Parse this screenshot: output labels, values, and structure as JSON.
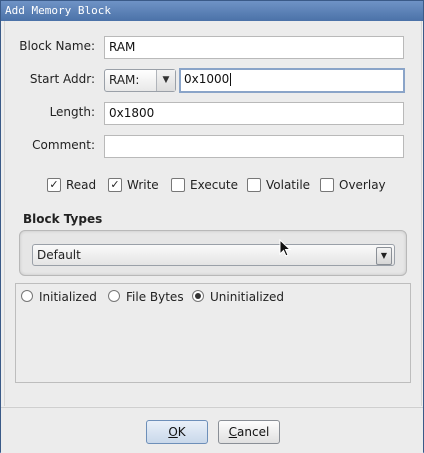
{
  "window": {
    "title": "Add Memory Block"
  },
  "form": {
    "block_name_label": "Block Name:",
    "block_name_value": "RAM",
    "start_addr_label": "Start Addr:",
    "space_value": "RAM:",
    "address_value": "0x1000",
    "length_label": "Length:",
    "length_value": "0x1800",
    "comment_label": "Comment:",
    "comment_value": ""
  },
  "permissions": [
    {
      "label": "Read",
      "checked": true
    },
    {
      "label": "Write",
      "checked": true
    },
    {
      "label": "Execute",
      "checked": false
    },
    {
      "label": "Volatile",
      "checked": false
    },
    {
      "label": "Overlay",
      "checked": false
    }
  ],
  "block_types": {
    "title": "Block Types",
    "selected": "Default"
  },
  "init_options": [
    {
      "label": "Initialized",
      "selected": false
    },
    {
      "label": "File Bytes",
      "selected": false
    },
    {
      "label": "Uninitialized",
      "selected": true
    }
  ],
  "buttons": {
    "ok_prefix": "O",
    "ok_rest": "K",
    "cancel_prefix": "C",
    "cancel_rest": "ancel"
  },
  "icons": {
    "checkbox_checked": "checkmark-icon",
    "dropdown": "chevron-down-icon",
    "cursor": "mouse-pointer-icon"
  }
}
